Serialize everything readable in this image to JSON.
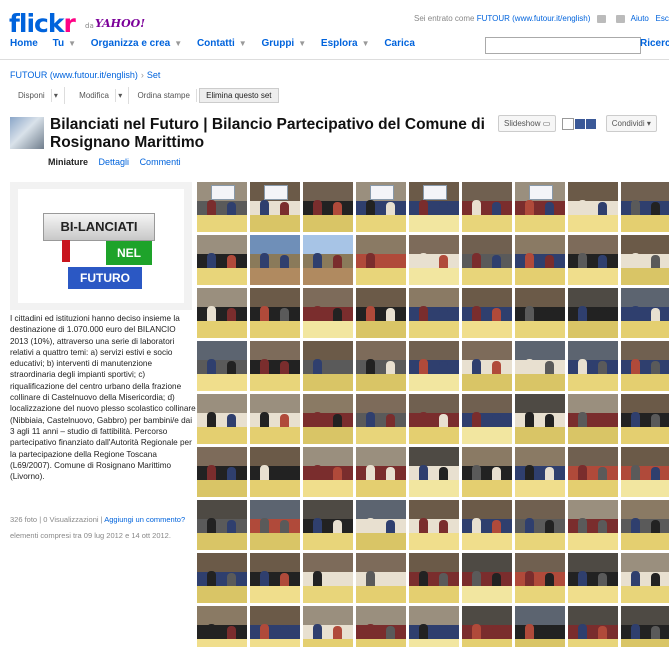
{
  "header": {
    "logo_flickr_a": "flick",
    "logo_flickr_b": "r",
    "logo_by": "da",
    "logo_yahoo": "YAHOO!",
    "signed_in_prefix": "Sei entrato come",
    "signed_in_user": "FUTOUR (www.futour.it/english)",
    "help": "Aiuto",
    "exit": "Esci",
    "nav": [
      "Home",
      "Tu",
      "Organizza e crea",
      "Contatti",
      "Gruppi",
      "Esplora",
      "Carica"
    ],
    "search_button": "Ricerca",
    "search_placeholder": ""
  },
  "breadcrumb": {
    "owner": "FUTOUR (www.futour.it/english)",
    "sep": "›",
    "current": "Set"
  },
  "actions": [
    "Disponi",
    "Modifica",
    "Ordina stampe",
    "Elimina questo set"
  ],
  "set": {
    "title": "Bilanciati nel Futuro | Bilancio Partecipativo del Comune di Rosignano Marittimo",
    "slideshow": "Slideshow",
    "share": "Condividi",
    "tabs": [
      "Miniature",
      "Dettagli",
      "Commenti"
    ]
  },
  "sidebar": {
    "logo_text_1": "BI-LANCIATI",
    "logo_text_2": "NEL",
    "logo_text_3": "FUTURO",
    "description": "I cittadini ed istituzioni hanno deciso insieme la destinazione di 1.070.000 euro del BILANCIO 2013 (10%), attraverso una serie di laboratori relativi a quattro temi: a) servizi estivi e socio educativi; b) interventi di manutenzione straordinaria degli impianti sportivi; c) riqualificazione del centro urbano della frazione collinare di Castelnuovo della Misericordia; d) localizzazione del nuovo plesso scolastico collinare (Nibbiaia, Castelnuovo, Gabbro) per bambini/e dai 3 agli 11 anni – studio di fattibilità. Percorso partecipativo finanziato dall'Autorità Regionale per la partecipazione della Regione Toscana (L69/2007). Comune di Rosignano Marittimo (Livorno).",
    "stats_prefix": "326 foto | 0 Visualizzazioni |",
    "add_comment": "Aggiungi un commento?",
    "dates": "elementi compresi tra 09 lug 2012 e 14 ott 2012."
  },
  "grid": {
    "columns": 9,
    "rows": 9,
    "palette_top": [
      "#6b5a48",
      "#8a7a64",
      "#4e4a44",
      "#9a8f7e",
      "#706050",
      "#5c6470",
      "#7d6b5a"
    ],
    "palette_table": [
      "#e8d57a",
      "#f0de8c",
      "#d9c566",
      "#e4cf70",
      "#f2e6a0"
    ],
    "palette_people": [
      "#222222",
      "#7a2d2d",
      "#2f3f6e",
      "#5a5a5a",
      "#b04a3a",
      "#e8e0d0"
    ]
  }
}
